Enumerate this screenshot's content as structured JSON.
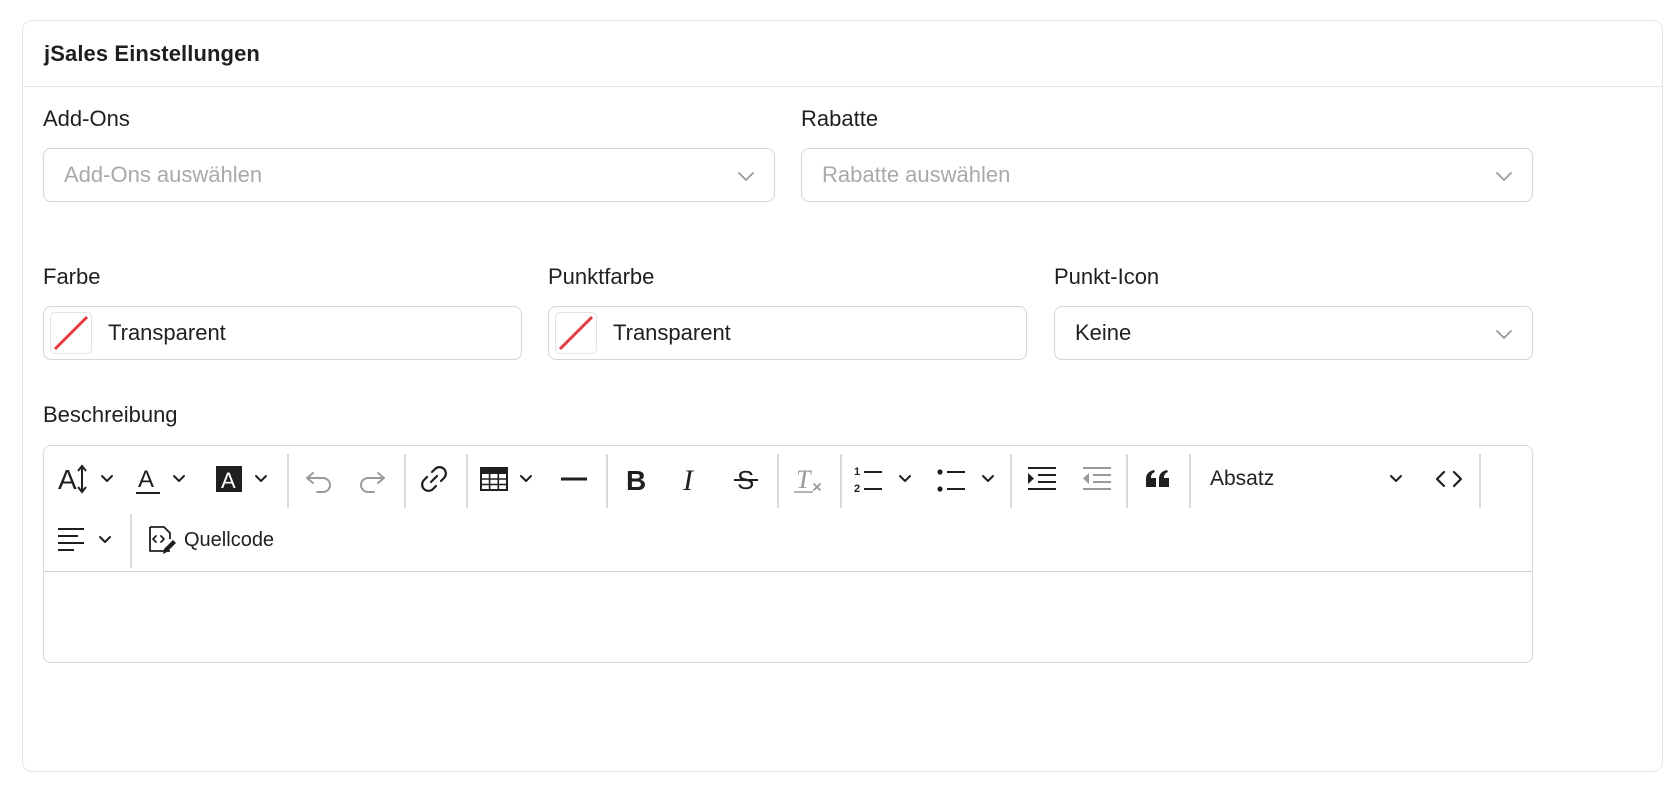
{
  "card": {
    "title": "jSales Einstellungen"
  },
  "addons": {
    "label": "Add-Ons",
    "placeholder": "Add-Ons auswählen"
  },
  "rabatte": {
    "label": "Rabatte",
    "placeholder": "Rabatte auswählen"
  },
  "farbe": {
    "label": "Farbe",
    "value": "Transparent"
  },
  "punktfarbe": {
    "label": "Punktfarbe",
    "value": "Transparent"
  },
  "punkticon": {
    "label": "Punkt-Icon",
    "value": "Keine"
  },
  "beschreibung": {
    "label": "Beschreibung",
    "toolbar": {
      "font_size_icon": "font-size-icon",
      "font_color_icon": "font-color-icon",
      "background_color_icon": "background-color-icon",
      "undo_icon": "undo-icon",
      "redo_icon": "redo-icon",
      "link_icon": "link-icon",
      "table_icon": "table-icon",
      "horizontal_line_icon": "horizontal-line-icon",
      "bold_icon": "bold-icon",
      "italic_icon": "italic-icon",
      "strikethrough_icon": "strikethrough-icon",
      "remove_format_icon": "remove-format-icon",
      "numbered_list_icon": "numbered-list-icon",
      "bulleted_list_icon": "bulleted-list-icon",
      "indent_icon": "indent-icon",
      "outdent_icon": "outdent-icon",
      "blockquote_icon": "blockquote-icon",
      "heading_value": "Absatz",
      "code_icon": "code-icon",
      "align_icon": "align-left-icon",
      "source_label": "Quellcode"
    },
    "content": ""
  },
  "colors": {
    "border": "#d6d6d6",
    "placeholder": "#a9a9a9",
    "text": "#1f1f1f",
    "transparent_slash": "#e0393e",
    "disabled_icon": "#9a9a9a"
  }
}
